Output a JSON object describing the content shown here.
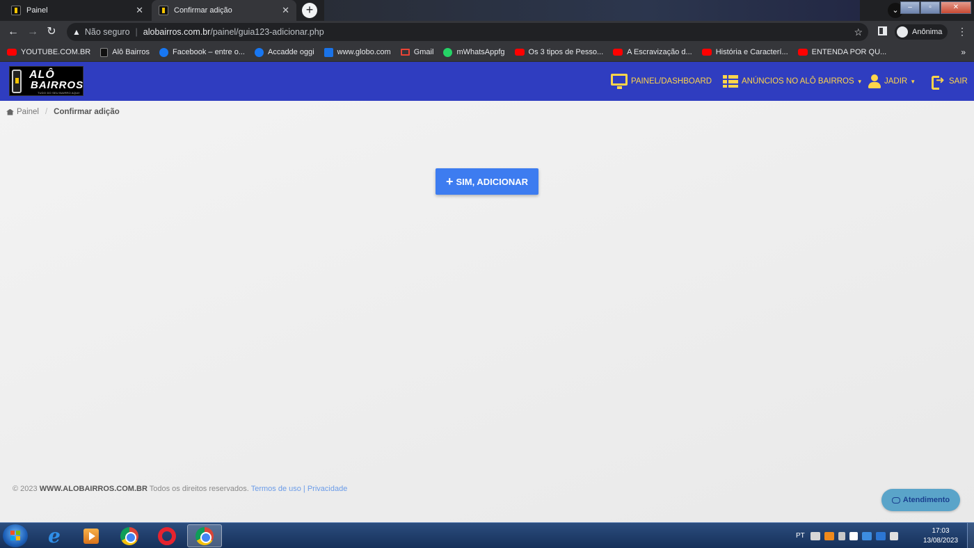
{
  "browser": {
    "tabs": [
      {
        "label": "Painel"
      },
      {
        "label": "Confirmar adição"
      }
    ],
    "address": {
      "security_label": "Não seguro",
      "host": "alobairros.com.br",
      "path": "/painel/guia123-adicionar.php"
    },
    "profile_label": "Anônima",
    "bookmarks": [
      {
        "label": "YOUTUBE.COM.BR",
        "icon": "youtube-icon"
      },
      {
        "label": "Alô Bairros",
        "icon": "alobairros-icon"
      },
      {
        "label": "Facebook – entre o...",
        "icon": "facebook-icon"
      },
      {
        "label": "Accadde oggi",
        "icon": "facebook-icon"
      },
      {
        "label": "www.globo.com",
        "icon": "globo-icon"
      },
      {
        "label": "Gmail",
        "icon": "gmail-icon"
      },
      {
        "label": "mWhatsAppfg",
        "icon": "whatsapp-icon"
      },
      {
        "label": "Os 3 tipos de Pesso...",
        "icon": "youtube-icon"
      },
      {
        "label": "A Escravização d...",
        "icon": "youtube-icon"
      },
      {
        "label": "História e Caracterí...",
        "icon": "youtube-icon"
      },
      {
        "label": "ENTENDA POR QU...",
        "icon": "youtube-icon"
      }
    ]
  },
  "site": {
    "logo": {
      "line1": "ALÔ",
      "line2": "BAIRROS",
      "tagline": "TUDO DO SEU BAIRRO AQUI!"
    },
    "nav": {
      "dashboard": "PAINEL/DASHBOARD",
      "ads": "ANÚNCIOS NO ALÔ BAIRROS",
      "user": "JADIR",
      "logout": "SAIR"
    },
    "colors": {
      "header": "#2f3dc0",
      "nav_text": "#ffd54a",
      "primary_button": "#3d7cf0",
      "chat_button": "#5aa4c9"
    }
  },
  "breadcrumb": {
    "home": "Painel",
    "current": "Confirmar adição"
  },
  "main": {
    "confirm_button": "SIM, ADICIONAR"
  },
  "footer": {
    "prefix": "© 2023",
    "site": "WWW.ALOBAIRROS.COM.BR",
    "rights": "Todos os direitos reservados.",
    "terms": "Termos de uso",
    "divider": "|",
    "privacy": "Privacidade"
  },
  "chat": {
    "label": "Atendimento"
  },
  "taskbar": {
    "lang": "PT",
    "time": "17:03",
    "date": "13/08/2023"
  }
}
